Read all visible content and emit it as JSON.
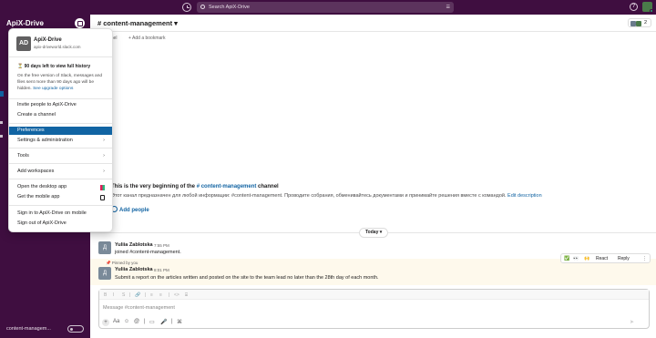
{
  "topbar": {
    "search_placeholder": "Search ApiX-Drive"
  },
  "sidebar": {
    "workspace": "ApiX-Drive",
    "footer_channel": "content-managem..."
  },
  "channel": {
    "name": "# content-management ▾",
    "member_count": "2"
  },
  "bookmarks": {
    "left_fragment": "nnel",
    "add_label": "+ Add a bookmark"
  },
  "intro": {
    "title_prefix": "This is the very beginning of the ",
    "channel_link": "# content-management",
    "title_suffix": " channel",
    "description": "Этот канал предназначен для любой информации: #content-management. Проводите собрания, обменивайтесь документами и принимайте решения вместе с командой.",
    "edit_link": "Edit description",
    "add_people": "Add people"
  },
  "day_divider": "Today ▾",
  "messages": [
    {
      "author": "Yuliia Zablotska",
      "time": "7:55 PM",
      "text": "joined #content-management.",
      "avatar": "Д"
    },
    {
      "author": "Yuliia Zablotska",
      "time": "8:01 PM",
      "text": "Submit a report on the articles written and posted on the site to the team lead no later than the 28th day of each month.",
      "avatar": "Д",
      "pinned_label": "Pinned by you"
    }
  ],
  "hover_toolbar": {
    "check": "✅",
    "eyes": "👀",
    "clap": "🙌",
    "react": "React",
    "reply": "Reply",
    "more": "⋮"
  },
  "composer": {
    "placeholder": "Message #content-management",
    "format_icons": [
      "B",
      "I",
      "S",
      "|",
      "🔗",
      "|",
      "≡",
      "≡",
      "|",
      "<>",
      "⌸"
    ],
    "action_icons": [
      "+",
      "Aa",
      "☺",
      "@",
      "|",
      "▭",
      "🎤",
      "|",
      "⌘"
    ],
    "send": "➤"
  },
  "menu": {
    "avatar": "AD",
    "workspace": "ApiX-Drive",
    "url": "apix-driveworld.slack.com",
    "history_title": "⏳ 90 days left to view full history",
    "history_note": "On the free version of Slack, messages and files sent more than 90 days ago will be hidden.",
    "history_link": "See upgrade options",
    "items": {
      "invite": "Invite people to ApiX-Drive",
      "create_channel": "Create a channel",
      "preferences": "Preferences",
      "settings": "Settings & administration",
      "tools": "Tools",
      "add_workspaces": "Add workspaces",
      "open_desktop": "Open the desktop app",
      "get_mobile": "Get the mobile app",
      "sign_in_mobile": "Sign in to ApiX-Drive on mobile",
      "sign_out": "Sign out of ApiX-Drive"
    },
    "arrow": "›"
  }
}
